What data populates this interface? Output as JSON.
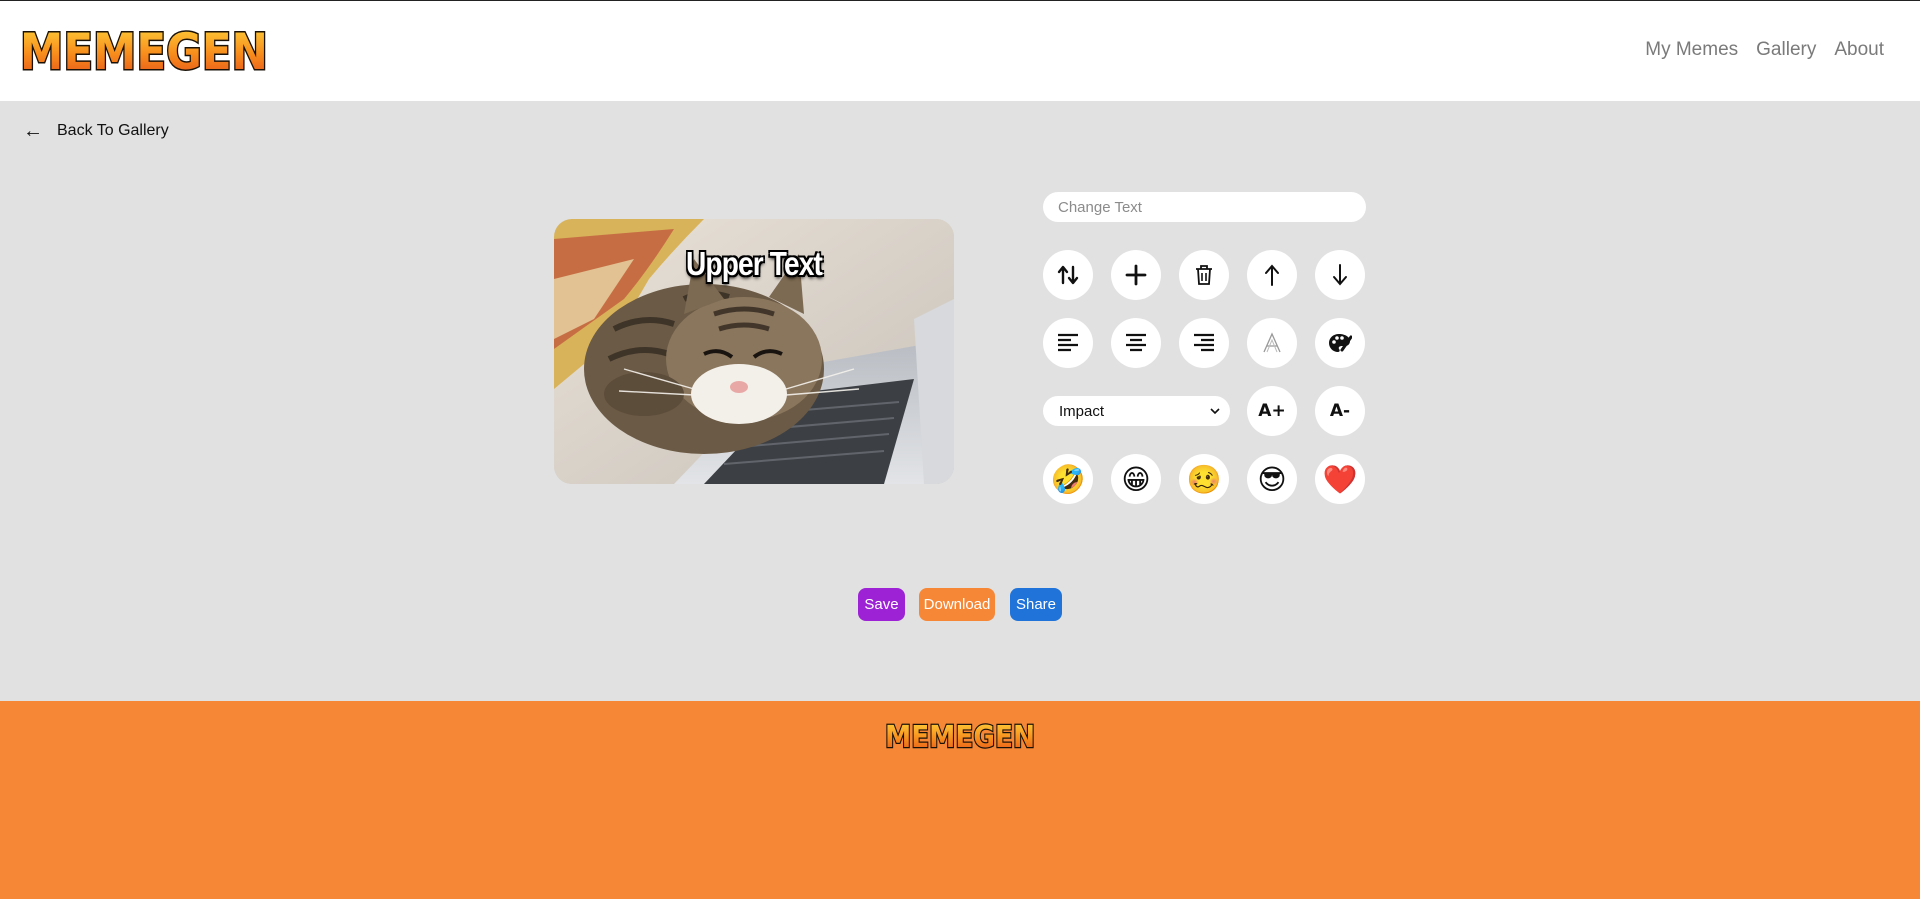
{
  "header": {
    "logo_text": "MEMEGEN",
    "nav": [
      {
        "label": "My Memes"
      },
      {
        "label": "Gallery"
      },
      {
        "label": "About"
      }
    ]
  },
  "back_link": {
    "arrow": "←",
    "label": "Back To Gallery"
  },
  "editor": {
    "meme_text": "Upper Text",
    "text_input": {
      "placeholder": "Change Text",
      "value": ""
    },
    "font_select": {
      "selected": "Impact"
    },
    "font_size_up_label": "A+",
    "font_size_down_label": "A-",
    "emojis": [
      "🤣",
      "😁",
      "🥴",
      "😎",
      "❤️"
    ]
  },
  "actions": {
    "save_label": "Save",
    "download_label": "Download",
    "share_label": "Share"
  },
  "footer": {
    "logo_text": "MEMEGEN"
  },
  "colors": {
    "brand_orange": "#f68737",
    "save": "#9d22d6",
    "download": "#f68737",
    "share": "#1f73d9",
    "background": "#e1e1e1"
  }
}
